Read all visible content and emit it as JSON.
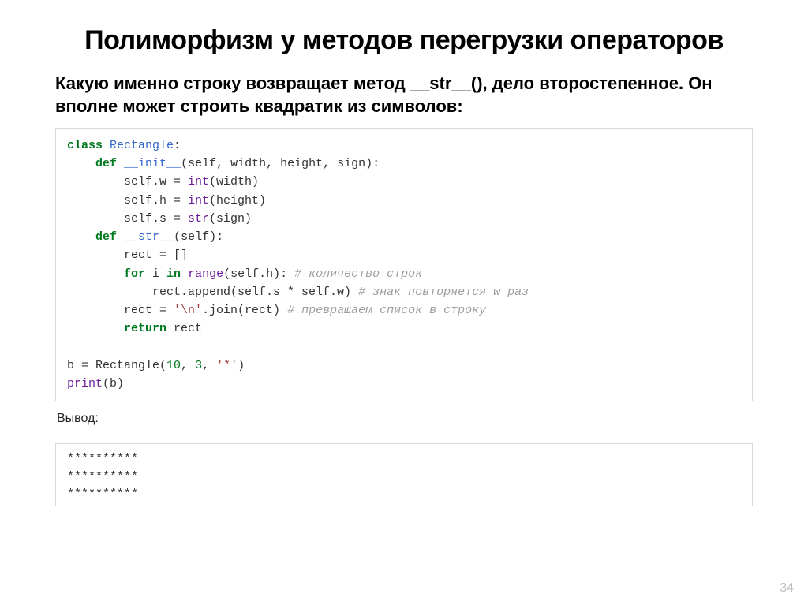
{
  "title": "Полиморфизм у методов перегрузки операторов",
  "subtitle": "Какую именно строку возвращает метод __str__(), дело второстепенное. Он вполне может строить квадратик из символов:",
  "code": {
    "l1_kw": "class",
    "l1_cls": "Rectangle",
    "l1_colon": ":",
    "l2_kw": "def",
    "l2_fn": "__init__",
    "l2_args": "(self, width, height, sign):",
    "l3": "        self.w = ",
    "l3_bi": "int",
    "l3_after": "(width)",
    "l4": "        self.h = ",
    "l4_bi": "int",
    "l4_after": "(height)",
    "l5": "        self.s = ",
    "l5_bi": "str",
    "l5_after": "(sign)",
    "l6_kw": "def",
    "l6_fn": "__str__",
    "l6_args": "(self):",
    "l7": "        rect = []",
    "l8_kw1": "for",
    "l8_var": " i ",
    "l8_kw2": "in",
    "l8_sp": " ",
    "l8_bi": "range",
    "l8_arg": "(self.h): ",
    "l8_cm": "# количество строк",
    "l9": "            rect.append(self.s * self.w) ",
    "l9_cm": "# знак повторяется w раз",
    "l10a": "        rect = ",
    "l10_s": "'\\n'",
    "l10b": ".join(rect) ",
    "l10_cm": "# превращаем список в строку",
    "l11_kw": "return",
    "l11_after": " rect",
    "l13a": "b = Rectangle(",
    "l13_n1": "10",
    "l13_c1": ", ",
    "l13_n2": "3",
    "l13_c2": ", ",
    "l13_s": "'*'",
    "l13_end": ")",
    "l14_bi": "print",
    "l14_arg": "(b)"
  },
  "output_label": "Вывод:",
  "output": "**********\n**********\n**********",
  "page_num": "34"
}
